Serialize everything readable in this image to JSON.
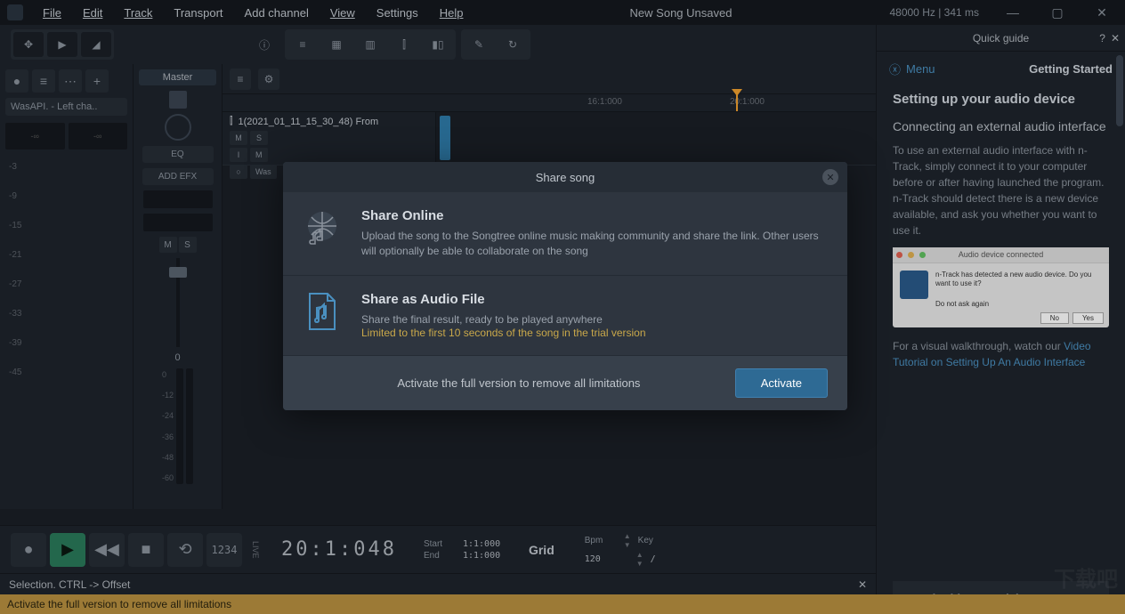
{
  "title": "New Song Unsaved",
  "audio_status": "48000 Hz | 341 ms",
  "menu": [
    "File",
    "Edit",
    "Track",
    "Transport",
    "Add channel",
    "View",
    "Settings",
    "Help"
  ],
  "menu_underline_idx": [
    0,
    0,
    0,
    -1,
    -1,
    0,
    -1,
    0
  ],
  "leftcol": {
    "device": "WasAPI.   - Left cha..",
    "scale": [
      "-3",
      "-9",
      "-15",
      "-21",
      "-27",
      "-33",
      "-39",
      "-45"
    ]
  },
  "mixer": {
    "master": "Master",
    "eq": "EQ",
    "addfx": "ADD EFX",
    "mute": "M",
    "solo": "S",
    "vol": "0",
    "meter_scale": [
      "0",
      "-12",
      "-24",
      "-36",
      "-48",
      "-60"
    ]
  },
  "track": {
    "name": "1(2021_01_11_15_30_48) From",
    "mute": "M",
    "solo": "S",
    "instr": "I",
    "instr_lbl": "M",
    "send": "○",
    "send_lbl": "Was"
  },
  "timeline": {
    "marks": [
      {
        "pos": 660,
        "txt": "16:1:000"
      },
      {
        "pos": 820,
        "txt": "20:1:000"
      }
    ],
    "playhead": 820
  },
  "transport": {
    "timecode": "20:1:048",
    "start_lbl": "Start",
    "start": "1:1:000",
    "end_lbl": "End",
    "end": "1:1:000",
    "snap": "Grid",
    "bpm_lbl": "Bpm",
    "bpm": "120",
    "key_lbl": "Key",
    "key": "/",
    "counter": "1234",
    "live": "LIVE"
  },
  "status": "Selection. CTRL -> Offset",
  "trial": "Activate the full version to remove all limitations",
  "modal": {
    "title": "Share song",
    "opt1_title": "Share Online",
    "opt1_desc": "Upload the song to the Songtree online music making community and share the link. Other users will optionally be able to collaborate on the song",
    "opt2_title": "Share as Audio File",
    "opt2_desc": "Share the final result, ready to be played anywhere",
    "opt2_limit": "Limited to the first 10 seconds of the song in the trial version",
    "ftr_text": "Activate the full version to remove all limitations",
    "activate": "Activate"
  },
  "guide": {
    "header": "Quick guide",
    "menu": "Menu",
    "page": "Getting Started",
    "h1": "Setting up your audio device",
    "h2": "Connecting an external audio interface",
    "p1": "To use an external audio interface with n-Track, simply connect it to your computer before or after having launched the program.",
    "p2": "n-Track should detect there is a new device available, and ask you whether you want to use it.",
    "img_title": "Audio device connected",
    "img_text": "n-Track has detected a new audio device. Do you want to use it?",
    "img_chk": "Do not ask again",
    "img_no": "No",
    "img_yes": "Yes",
    "p3a": "For a visual walkthrough, watch our ",
    "link": "Video Tutorial on Setting Up An Audio Interface",
    "cta": "Watch Video Tutorial >"
  }
}
